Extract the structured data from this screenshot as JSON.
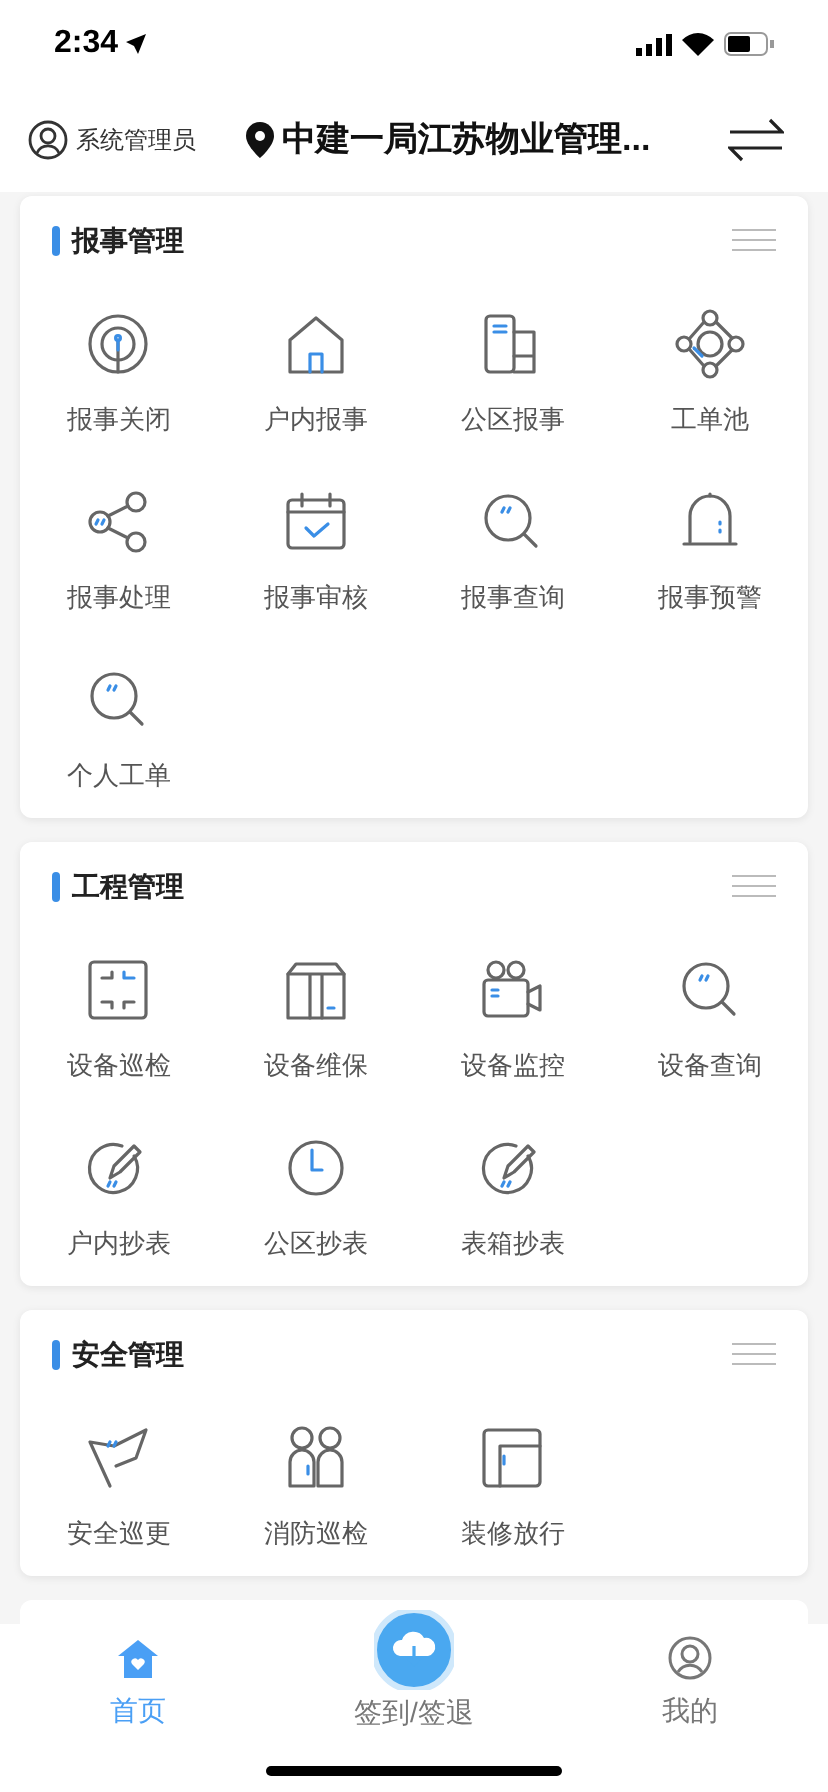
{
  "status_bar": {
    "time": "2:34"
  },
  "header": {
    "user": "系统管理员",
    "location": "中建一局江苏物业管理..."
  },
  "sections": [
    {
      "title": "报事管理",
      "items": [
        "报事关闭",
        "户内报事",
        "公区报事",
        "工单池",
        "报事处理",
        "报事审核",
        "报事查询",
        "报事预警",
        "个人工单"
      ]
    },
    {
      "title": "工程管理",
      "items": [
        "设备巡检",
        "设备维保",
        "设备监控",
        "设备查询",
        "户内抄表",
        "公区抄表",
        "表箱抄表"
      ]
    },
    {
      "title": "安全管理",
      "items": [
        "安全巡更",
        "消防巡检",
        "装修放行"
      ]
    }
  ],
  "tabs": [
    {
      "label": "首页",
      "selected": true,
      "kind": "tab"
    },
    {
      "label": "签到/签退",
      "selected": false,
      "kind": "center"
    },
    {
      "label": "我的",
      "selected": false,
      "kind": "tab"
    }
  ]
}
